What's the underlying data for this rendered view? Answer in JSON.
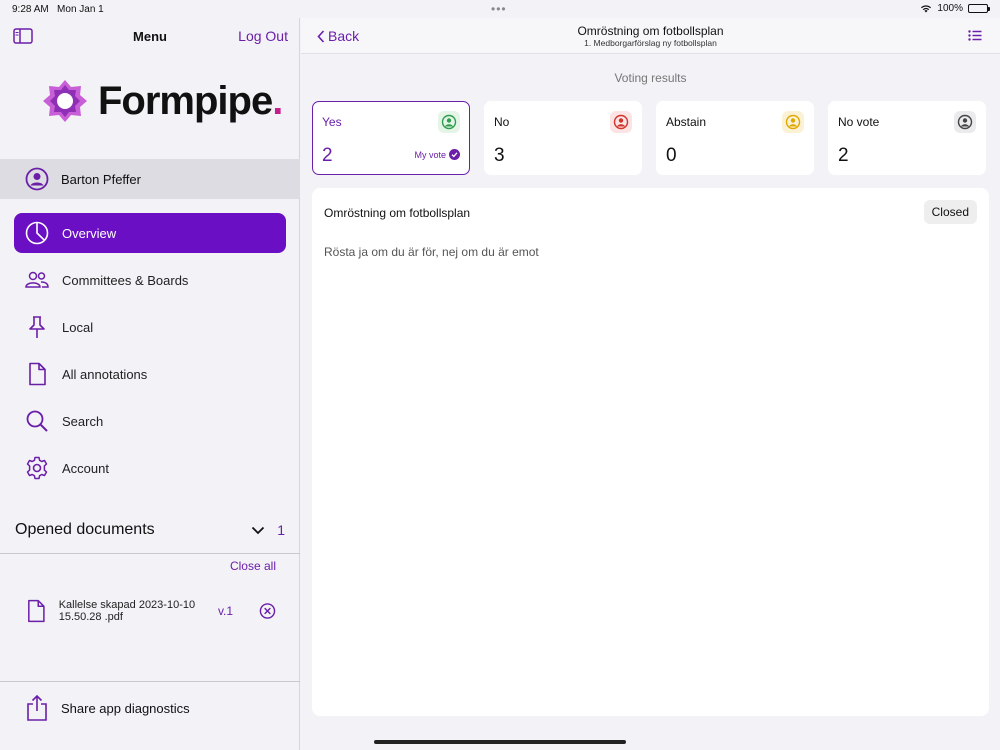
{
  "status": {
    "time": "9:28 AM",
    "date": "Mon Jan 1",
    "battery": "100%"
  },
  "sidebar": {
    "title": "Menu",
    "logout_label": "Log Out",
    "logo_text": "Formpipe",
    "logo_dot": ".",
    "user_name": "Barton Pfeffer",
    "nav": [
      {
        "label": "Overview",
        "icon": "pie-chart-icon",
        "active": true
      },
      {
        "label": "Committees & Boards",
        "icon": "people-icon"
      },
      {
        "label": "Local",
        "icon": "pin-icon"
      },
      {
        "label": "All annotations",
        "icon": "document-icon"
      },
      {
        "label": "Search",
        "icon": "search-icon"
      },
      {
        "label": "Account",
        "icon": "gear-icon"
      }
    ],
    "opened_documents_label": "Opened documents",
    "opened_documents_count": "1",
    "close_all_label": "Close all",
    "document": {
      "name": "Kallelse skapad  2023-10-10 15.50.28 .pdf",
      "version": "v.1"
    },
    "share_label": "Share app diagnostics"
  },
  "topbar": {
    "back_label": "Back",
    "title": "Omröstning om fotbollsplan",
    "subtitle": "1. Medborgarförslag ny fotbollsplan"
  },
  "voting": {
    "title": "Voting results",
    "cards": [
      {
        "label": "Yes",
        "value": "2",
        "my_vote": "My vote",
        "color": "#2e9d4f",
        "bg": "#e4f5e8"
      },
      {
        "label": "No",
        "value": "3",
        "color": "#d0342c",
        "bg": "#fbe4e3"
      },
      {
        "label": "Abstain",
        "value": "0",
        "color": "#e0a800",
        "bg": "#fbf2d6"
      },
      {
        "label": "No vote",
        "value": "2",
        "color": "#444444",
        "bg": "#ebebee"
      }
    ]
  },
  "panel": {
    "title": "Omröstning om fotbollsplan",
    "status": "Closed",
    "description": "Rösta ja om du är för, nej om du är emot"
  },
  "colors": {
    "accent": "#6b0fc4",
    "brand_dot": "#c71d8b"
  }
}
